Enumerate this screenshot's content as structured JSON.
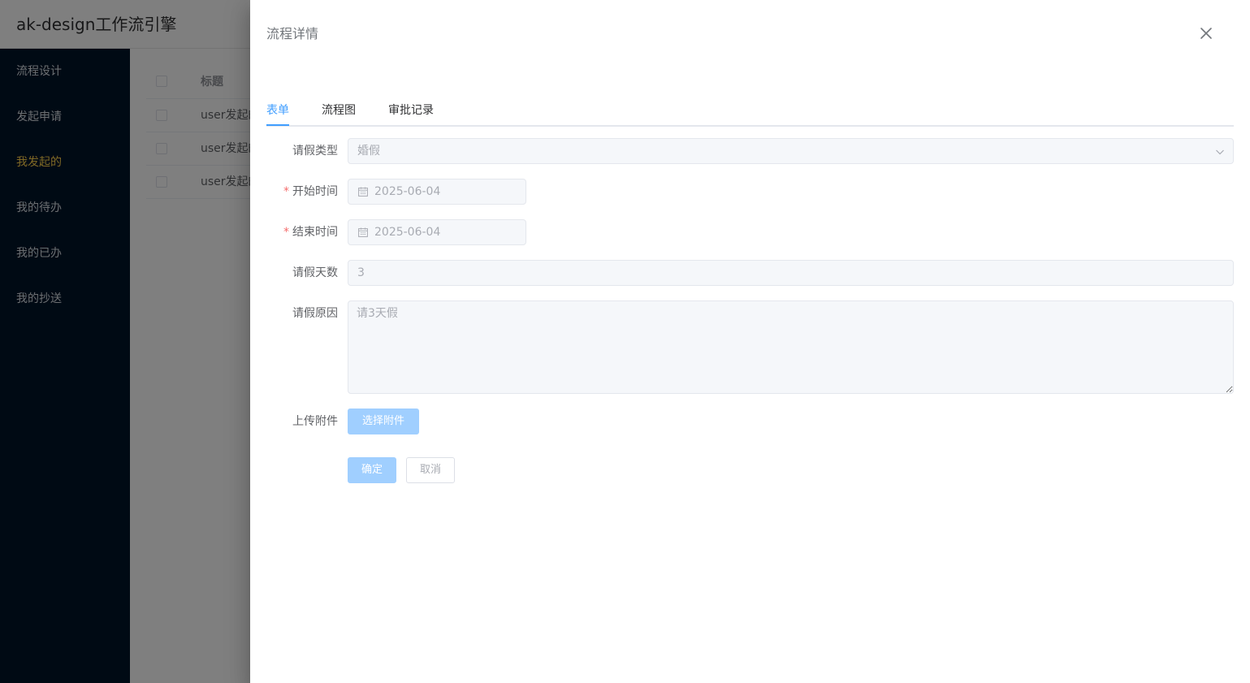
{
  "app": {
    "title": "ak-design工作流引擎"
  },
  "sidebar": {
    "items": [
      {
        "label": "流程设计"
      },
      {
        "label": "发起申请"
      },
      {
        "label": "我发起的",
        "active": true
      },
      {
        "label": "我的待办"
      },
      {
        "label": "我的已办"
      },
      {
        "label": "我的抄送"
      }
    ]
  },
  "table": {
    "header": {
      "title": "标题"
    },
    "rows": [
      {
        "title": "user发起的"
      },
      {
        "title": "user发起的"
      },
      {
        "title": "user发起的"
      }
    ]
  },
  "drawer": {
    "title": "流程详情",
    "tabs": [
      {
        "label": "表单",
        "active": true
      },
      {
        "label": "流程图"
      },
      {
        "label": "审批记录"
      }
    ],
    "form": {
      "leave_type": {
        "label": "请假类型",
        "value": "婚假"
      },
      "start_time": {
        "label": "开始时间",
        "value": "2025-06-04",
        "required": true
      },
      "end_time": {
        "label": "结束时间",
        "value": "2025-06-04",
        "required": true
      },
      "days": {
        "label": "请假天数",
        "value": "3"
      },
      "reason": {
        "label": "请假原因",
        "placeholder": "请3天假"
      },
      "attachment": {
        "label": "上传附件",
        "button": "选择附件"
      },
      "confirm": "确定",
      "cancel": "取消"
    },
    "required_mark": "*"
  },
  "colors": {
    "accent": "#409eff",
    "sidebar_bg": "#001529",
    "menu_active": "#ffd04b"
  }
}
